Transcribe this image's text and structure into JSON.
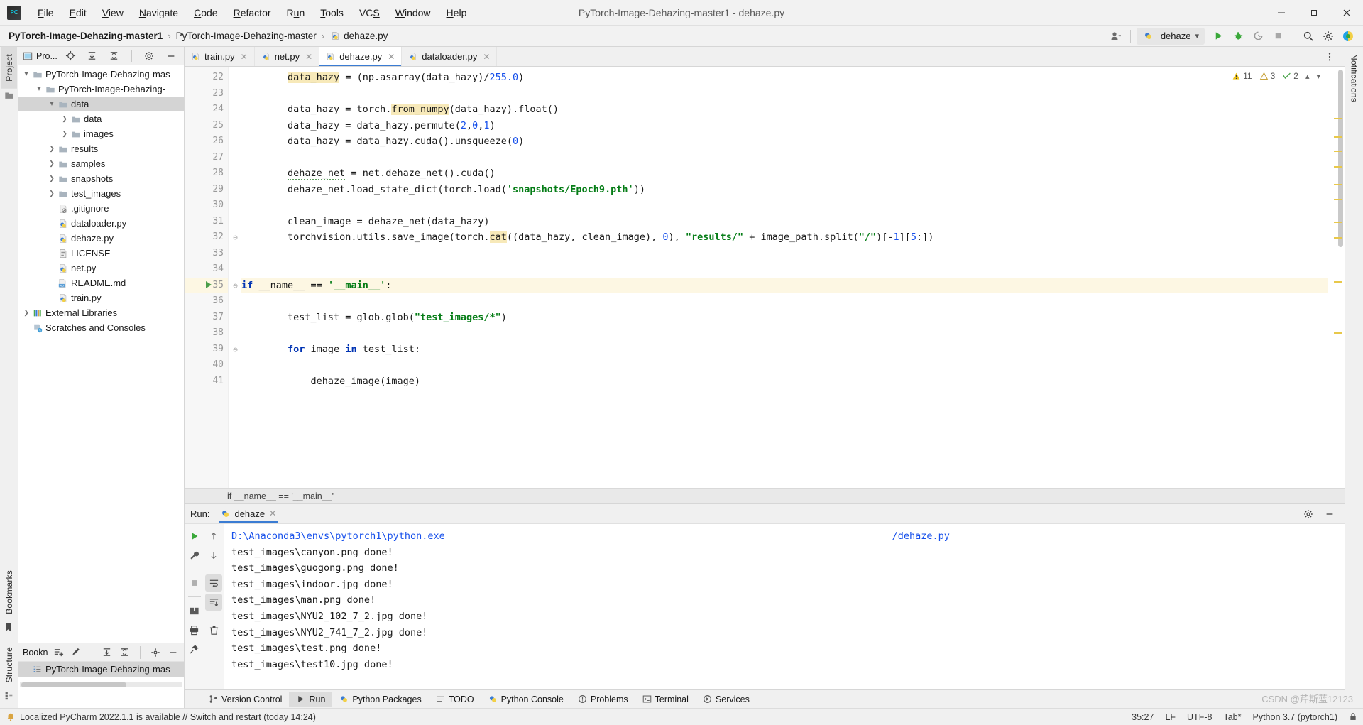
{
  "window": {
    "title": "PyTorch-Image-Dehazing-master1 - dehaze.py",
    "minimize_label": "─",
    "maximize_label": "❐",
    "close_label": "✕"
  },
  "menu": {
    "items": [
      "File",
      "Edit",
      "View",
      "Navigate",
      "Code",
      "Refactor",
      "Run",
      "Tools",
      "VCS",
      "Window",
      "Help"
    ]
  },
  "navbar": {
    "breadcrumb": [
      "PyTorch-Image-Dehazing-master1",
      "PyTorch-Image-Dehazing-master",
      "dehaze.py"
    ],
    "separator": "›",
    "run_config": "dehaze",
    "dropdown_caret": "⌄",
    "icons": [
      "user-icon",
      "run-icon",
      "debug-icon",
      "coverage-icon",
      "stop-icon",
      "search-icon",
      "settings-icon",
      "ide-assistant-icon"
    ]
  },
  "left_strip": {
    "tabs": [
      "Project",
      "Bookmarks",
      "Structure"
    ]
  },
  "project_tool": {
    "header_title": "Pro...",
    "header_icons": [
      "locate-icon",
      "expand-all-icon",
      "collapse-all-icon",
      "gear-icon",
      "hide-icon"
    ],
    "tree": [
      {
        "label": "PyTorch-Image-Dehazing-mas",
        "depth": 0,
        "arrow": "⌄",
        "icon": "folder-icon",
        "selected": false
      },
      {
        "label": "PyTorch-Image-Dehazing-",
        "depth": 1,
        "arrow": "⌄",
        "icon": "folder-icon",
        "selected": false
      },
      {
        "label": "data",
        "depth": 2,
        "arrow": "⌄",
        "icon": "folder-icon",
        "selected": true
      },
      {
        "label": "data",
        "depth": 3,
        "arrow": "›",
        "icon": "folder-icon",
        "selected": false
      },
      {
        "label": "images",
        "depth": 3,
        "arrow": "›",
        "icon": "folder-icon",
        "selected": false
      },
      {
        "label": "results",
        "depth": 2,
        "arrow": "›",
        "icon": "folder-icon",
        "selected": false
      },
      {
        "label": "samples",
        "depth": 2,
        "arrow": "›",
        "icon": "folder-icon",
        "selected": false
      },
      {
        "label": "snapshots",
        "depth": 2,
        "arrow": "›",
        "icon": "folder-icon",
        "selected": false
      },
      {
        "label": "test_images",
        "depth": 2,
        "arrow": "›",
        "icon": "folder-icon",
        "selected": false
      },
      {
        "label": ".gitignore",
        "depth": 2,
        "arrow": "",
        "icon": "gitignore-file-icon",
        "selected": false
      },
      {
        "label": "dataloader.py",
        "depth": 2,
        "arrow": "",
        "icon": "python-file-icon",
        "selected": false
      },
      {
        "label": "dehaze.py",
        "depth": 2,
        "arrow": "",
        "icon": "python-file-icon",
        "selected": false
      },
      {
        "label": "LICENSE",
        "depth": 2,
        "arrow": "",
        "icon": "text-file-icon",
        "selected": false
      },
      {
        "label": "net.py",
        "depth": 2,
        "arrow": "",
        "icon": "python-file-icon",
        "selected": false
      },
      {
        "label": "README.md",
        "depth": 2,
        "arrow": "",
        "icon": "markdown-file-icon",
        "selected": false
      },
      {
        "label": "train.py",
        "depth": 2,
        "arrow": "",
        "icon": "python-file-icon",
        "selected": false
      },
      {
        "label": "External Libraries",
        "depth": 0,
        "arrow": "›",
        "icon": "library-icon",
        "selected": false
      },
      {
        "label": "Scratches and Consoles",
        "depth": 0,
        "arrow": "",
        "icon": "scratches-icon",
        "selected": false
      }
    ]
  },
  "bookmarks_tool": {
    "header_title": "Bookn",
    "header_icons": [
      "add-bookmark-icon",
      "edit-icon",
      "expand-all-icon",
      "collapse-all-icon",
      "gear-icon",
      "hide-icon"
    ],
    "items": [
      {
        "label": "PyTorch-Image-Dehazing-mas",
        "icon": "bookmark-list-icon"
      }
    ]
  },
  "editor": {
    "tabs": [
      {
        "label": "train.py",
        "icon": "python-file-icon",
        "active": false,
        "close": "✕"
      },
      {
        "label": "net.py",
        "icon": "python-file-icon",
        "active": false,
        "close": "✕"
      },
      {
        "label": "dehaze.py",
        "icon": "python-file-icon",
        "active": true,
        "close": "✕"
      },
      {
        "label": "dataloader.py",
        "icon": "python-file-icon",
        "active": false,
        "close": "✕"
      }
    ],
    "tab_options_icon": "more-options-icon",
    "inspections": {
      "warnings": "11",
      "weak_warnings": "3",
      "typos": "2",
      "warning_icon": "warning-triangle-icon",
      "weak_warning_icon": "weak-warning-icon",
      "typo_icon": "typo-icon",
      "prev_icon": "⌃",
      "next_icon": "⌄"
    },
    "breadcrumb_line": "if __name__ == '__main__'",
    "lines": [
      {
        "num": "22",
        "text": "        data_hazy = (np.asarray(data_hazy)/255.0)"
      },
      {
        "num": "23",
        "text": ""
      },
      {
        "num": "24",
        "text": "        data_hazy = torch.from_numpy(data_hazy).float()"
      },
      {
        "num": "25",
        "text": "        data_hazy = data_hazy.permute(2,0,1)"
      },
      {
        "num": "26",
        "text": "        data_hazy = data_hazy.cuda().unsqueeze(0)"
      },
      {
        "num": "27",
        "text": ""
      },
      {
        "num": "28",
        "text": "        dehaze_net = net.dehaze_net().cuda()"
      },
      {
        "num": "29",
        "text": "        dehaze_net.load_state_dict(torch.load('snapshots/Epoch9.pth'))"
      },
      {
        "num": "30",
        "text": ""
      },
      {
        "num": "31",
        "text": "        clean_image = dehaze_net(data_hazy)"
      },
      {
        "num": "32",
        "text": "        torchvision.utils.save_image(torch.cat((data_hazy, clean_image), 0), \"results/\" + image_path.split(\"/\")[-1][5:])"
      },
      {
        "num": "33",
        "text": ""
      },
      {
        "num": "34",
        "text": ""
      },
      {
        "num": "35",
        "text": "if __name__ == '__main__':"
      },
      {
        "num": "36",
        "text": ""
      },
      {
        "num": "37",
        "text": "        test_list = glob.glob(\"test_images/*\")"
      },
      {
        "num": "38",
        "text": ""
      },
      {
        "num": "39",
        "text": "        for image in test_list:"
      },
      {
        "num": "40",
        "text": ""
      },
      {
        "num": "41",
        "text": "            dehaze_image(image)"
      }
    ]
  },
  "run_panel": {
    "label": "Run:",
    "tab_label": "dehaze",
    "tab_icon": "python-file-icon",
    "tab_close": "✕",
    "header_icons": [
      "settings-icon",
      "hide-icon"
    ],
    "toolbar_icons": [
      "rerun-icon",
      "wrench-icon",
      "stop-icon",
      "layout-icon",
      "scroll-up-icon",
      "scroll-down-icon",
      "soft-wrap-icon",
      "scroll-to-end-icon",
      "print-icon",
      "clear-all-icon",
      "pin-icon"
    ],
    "console_lines": [
      {
        "text": "D:\\Anaconda3\\envs\\pytorch1\\python.exe",
        "type": "command",
        "blurred_tail": "                                                                        ",
        "tail": "/dehaze.py"
      },
      {
        "text": "test_images\\canyon.png done!",
        "type": "output"
      },
      {
        "text": "test_images\\guogong.png done!",
        "type": "output"
      },
      {
        "text": "test_images\\indoor.jpg done!",
        "type": "output"
      },
      {
        "text": "test_images\\man.png done!",
        "type": "output"
      },
      {
        "text": "test_images\\NYU2_102_7_2.jpg done!",
        "type": "output"
      },
      {
        "text": "test_images\\NYU2_741_7_2.jpg done!",
        "type": "output"
      },
      {
        "text": "test_images\\test.png done!",
        "type": "output"
      },
      {
        "text": "test_images\\test10.jpg done!",
        "type": "output"
      }
    ]
  },
  "bottom_bar": {
    "items": [
      {
        "label": "Version Control",
        "icon": "branch-icon",
        "active": false
      },
      {
        "label": "Run",
        "icon": "run-icon",
        "active": true
      },
      {
        "label": "Python Packages",
        "icon": "python-packages-icon",
        "active": false
      },
      {
        "label": "TODO",
        "icon": "todo-icon",
        "active": false
      },
      {
        "label": "Python Console",
        "icon": "python-console-icon",
        "active": false
      },
      {
        "label": "Problems",
        "icon": "problems-icon",
        "active": false
      },
      {
        "label": "Terminal",
        "icon": "terminal-icon",
        "active": false
      },
      {
        "label": "Services",
        "icon": "services-icon",
        "active": false
      }
    ]
  },
  "status_bar": {
    "message": "Localized PyCharm 2022.1.1 is available // Switch and restart (today 14:24)",
    "message_icon": "notification-icon",
    "caret_position": "35:27",
    "line_separator": "LF",
    "encoding": "UTF-8",
    "indent": "Tab*",
    "interpreter": "Python 3.7 (pytorch1)",
    "lock_icon": "lock-icon"
  },
  "right_strip": {
    "tabs": [
      "Notifications"
    ]
  },
  "watermark": "CSDN @芹斯蓝12123",
  "colors": {
    "accent": "#3b7cd3",
    "keyword": "#0033b3",
    "string": "#067d17",
    "number": "#1750eb",
    "highlight": "#f7e9b9",
    "line_highlight": "#fdf7e3",
    "run_green": "#4a9e4a"
  }
}
